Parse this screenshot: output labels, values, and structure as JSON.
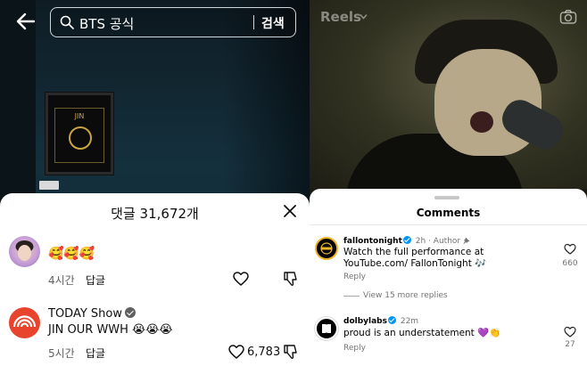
{
  "left": {
    "search": {
      "query": "BTS 공식",
      "button_label": "검색"
    },
    "plaque_text": "JIN",
    "comments_sheet": {
      "title": "댓글 31,672개",
      "comments": [
        {
          "author": "",
          "text": "🥰🥰🥰",
          "time": "4시간",
          "reply_label": "답글",
          "likes": ""
        },
        {
          "author": "TODAY Show",
          "verified": true,
          "text": "JIN OUR WWH 😭😭😭",
          "time": "5시간",
          "reply_label": "답글",
          "likes": "6,783"
        }
      ]
    }
  },
  "right": {
    "reels_label": "Reels",
    "comments_title": "Comments",
    "comments": [
      {
        "user": "fallontonight",
        "verified": true,
        "time": "2h",
        "author_tag": "· Author",
        "text": "Watch the full performance at YouTube.com/ FallonTonight 🎶",
        "reply_label": "Reply",
        "likes": "660",
        "more_replies": "View 15 more replies"
      },
      {
        "user": "dolbylabs",
        "verified": true,
        "time": "22m",
        "text": "proud is an understatement 💜👏",
        "reply_label": "Reply",
        "likes": "27"
      }
    ]
  },
  "colors": {
    "youtube_text": "#0f0f0f",
    "instagram_verified": "#0095f6",
    "today_red": "#e8432c"
  }
}
